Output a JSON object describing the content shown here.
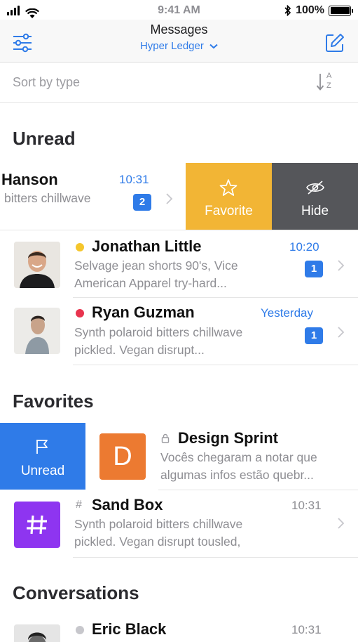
{
  "status_bar": {
    "time": "9:41 AM",
    "battery": "100%"
  },
  "nav": {
    "title": "Messages",
    "subtitle": "Hyper Ledger"
  },
  "sort": {
    "placeholder": "Sort by type",
    "sort_icon_a": "A",
    "sort_icon_z": "Z"
  },
  "sections": {
    "unread": "Unread",
    "favorites": "Favorites",
    "conversations": "Conversations"
  },
  "unread_swiped": {
    "name": "Hanson",
    "preview": "bitters chillwave",
    "time": "10:31",
    "badge": "2",
    "actions": [
      {
        "label": "Favorite",
        "icon": "star-icon",
        "color": "#f2b535"
      },
      {
        "label": "Hide",
        "icon": "eye-slash-icon",
        "color": "#55565a"
      }
    ]
  },
  "unread_items": [
    {
      "name": "Jonathan Little",
      "preview_line1": "Selvage jean shorts 90's, Vice",
      "preview_line2": "American Apparel try-hard...",
      "time": "10:20",
      "badge": "1",
      "status_color": "#f5c62c"
    },
    {
      "name": "Ryan Guzman",
      "preview_line1": "Synth polaroid bitters chillwave",
      "preview_line2": "pickled. Vegan disrupt...",
      "time": "Yesterday",
      "badge": "1",
      "status_color": "#e8344e"
    }
  ],
  "favorites_swiped": {
    "action": {
      "label": "Unread",
      "icon": "flag-icon",
      "color": "#2f7be8"
    },
    "avatar_letter": "D",
    "avatar_color": "#ec7a31",
    "name": "Design Sprint",
    "preview_line1": "Vocês chegaram a notar que",
    "preview_line2": "algumas infos estão quebr..."
  },
  "favorites_items": [
    {
      "name": "Sand Box",
      "preview_line1": "Synth polaroid bitters chillwave",
      "preview_line2": "pickled. Vegan disrupt tousled,",
      "time": "10:31",
      "avatar_color": "#8e35f0",
      "avatar_symbol": "#"
    }
  ],
  "conversations_items": [
    {
      "name": "Eric Black",
      "time": "10:31",
      "status_color": "#c7c7cc"
    }
  ]
}
